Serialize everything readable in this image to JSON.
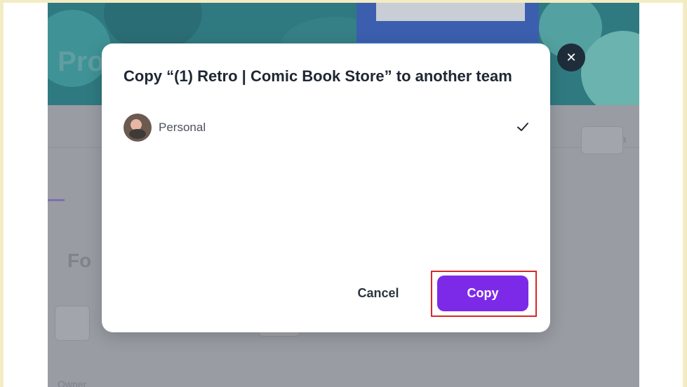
{
  "background": {
    "hero_text": "Pro",
    "ghost_labels": [
      "Fo",
      "Ma",
      "Owner"
    ]
  },
  "dialog": {
    "title": "Copy “(1) Retro | Comic Book Store” to another team",
    "teams": [
      {
        "label": "Personal",
        "selected": true
      }
    ],
    "cancel_label": "Cancel",
    "copy_label": "Copy",
    "close_symbol": "✕"
  },
  "colors": {
    "accent": "#7d2ae8",
    "highlight": "#d62828",
    "overlay": "#9a9ca4",
    "frame": "#f3ecc3"
  },
  "icons": {
    "close": "close-icon",
    "check": "check-icon",
    "avatar": "avatar"
  }
}
